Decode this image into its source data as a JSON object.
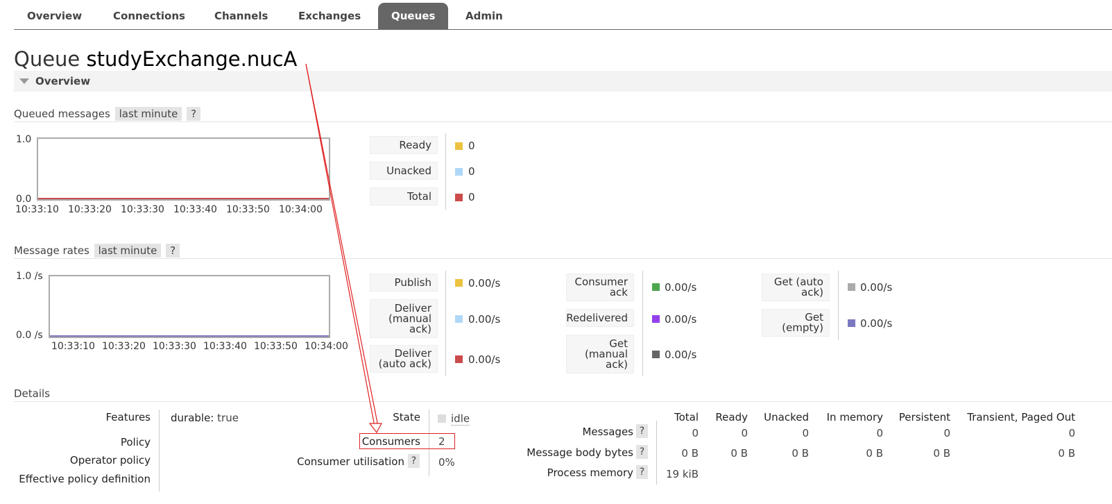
{
  "nav": {
    "tabs": [
      {
        "label": "Overview"
      },
      {
        "label": "Connections"
      },
      {
        "label": "Channels"
      },
      {
        "label": "Exchanges"
      },
      {
        "label": "Queues"
      },
      {
        "label": "Admin"
      }
    ],
    "active": "Queues"
  },
  "page": {
    "title_prefix": "Queue",
    "queue_name": "studyExchange.nucA",
    "overview_label": "Overview"
  },
  "queued_messages": {
    "label": "Queued messages",
    "range": "last minute",
    "help": "?",
    "chart_data": {
      "type": "line",
      "x": [
        "10:33:10",
        "10:33:20",
        "10:33:30",
        "10:33:40",
        "10:33:50",
        "10:34:00"
      ],
      "ylim": [
        0.0,
        1.0
      ],
      "y_ticks": [
        "1.0",
        "0.0"
      ],
      "series": [
        {
          "name": "Ready",
          "values": [
            0,
            0,
            0,
            0,
            0,
            0
          ]
        },
        {
          "name": "Unacked",
          "values": [
            0,
            0,
            0,
            0,
            0,
            0
          ]
        },
        {
          "name": "Total",
          "values": [
            0,
            0,
            0,
            0,
            0,
            0
          ]
        }
      ]
    },
    "legend": [
      {
        "label": "Ready",
        "value": "0",
        "color": "#edc240"
      },
      {
        "label": "Unacked",
        "value": "0",
        "color": "#afd8f8"
      },
      {
        "label": "Total",
        "value": "0",
        "color": "#cb4b4b"
      }
    ]
  },
  "message_rates": {
    "label": "Message rates",
    "range": "last minute",
    "help": "?",
    "chart_data": {
      "type": "line",
      "x": [
        "10:33:10",
        "10:33:20",
        "10:33:30",
        "10:33:40",
        "10:33:50",
        "10:34:00"
      ],
      "ylim": [
        0.0,
        1.0
      ],
      "y_ticks": [
        "1.0 /s",
        "0.0 /s"
      ],
      "series": [
        {
          "name": "Publish",
          "values": [
            0,
            0,
            0,
            0,
            0,
            0
          ]
        },
        {
          "name": "Deliver (manual ack)",
          "values": [
            0,
            0,
            0,
            0,
            0,
            0
          ]
        },
        {
          "name": "Deliver (auto ack)",
          "values": [
            0,
            0,
            0,
            0,
            0,
            0
          ]
        },
        {
          "name": "Consumer ack",
          "values": [
            0,
            0,
            0,
            0,
            0,
            0
          ]
        },
        {
          "name": "Redelivered",
          "values": [
            0,
            0,
            0,
            0,
            0,
            0
          ]
        },
        {
          "name": "Get (manual ack)",
          "values": [
            0,
            0,
            0,
            0,
            0,
            0
          ]
        },
        {
          "name": "Get (auto ack)",
          "values": [
            0,
            0,
            0,
            0,
            0,
            0
          ]
        },
        {
          "name": "Get (empty)",
          "values": [
            0,
            0,
            0,
            0,
            0,
            0
          ]
        }
      ]
    },
    "legend_col1": [
      {
        "label": "Publish",
        "value": "0.00/s",
        "color": "#edc240"
      },
      {
        "label": "Deliver (manual ack)",
        "value": "0.00/s",
        "color": "#afd8f8"
      },
      {
        "label": "Deliver (auto ack)",
        "value": "0.00/s",
        "color": "#cb4b4b"
      }
    ],
    "legend_col2": [
      {
        "label": "Consumer ack",
        "value": "0.00/s",
        "color": "#4da74d"
      },
      {
        "label": "Redelivered",
        "value": "0.00/s",
        "color": "#9440ed"
      },
      {
        "label": "Get (manual ack)",
        "value": "0.00/s",
        "color": "#666666"
      }
    ],
    "legend_col3": [
      {
        "label": "Get (auto ack)",
        "value": "0.00/s",
        "color": "#aaaaaa"
      },
      {
        "label": "Get (empty)",
        "value": "0.00/s",
        "color": "#7c79c3"
      }
    ]
  },
  "details": {
    "label": "Details",
    "features_label": "Features",
    "features_key": "durable:",
    "features_value": "true",
    "policy_label": "Policy",
    "operator_policy_label": "Operator policy",
    "effective_policy_label": "Effective policy definition",
    "state_label": "State",
    "state_value": "idle",
    "consumers_label": "Consumers",
    "consumers_value": "2",
    "utilisation_label": "Consumer utilisation",
    "utilisation_value": "0%",
    "help": "?"
  },
  "stats": {
    "columns": [
      "Total",
      "Ready",
      "Unacked",
      "In memory",
      "Persistent",
      "Transient, Paged Out"
    ],
    "rows": [
      {
        "label": "Messages",
        "values": [
          "0",
          "0",
          "0",
          "0",
          "0",
          "0"
        ]
      },
      {
        "label": "Message body bytes",
        "values": [
          "0 B",
          "0 B",
          "0 B",
          "0 B",
          "0 B",
          "0 B"
        ]
      },
      {
        "label": "Process memory",
        "values": [
          "19 kiB"
        ]
      }
    ]
  }
}
